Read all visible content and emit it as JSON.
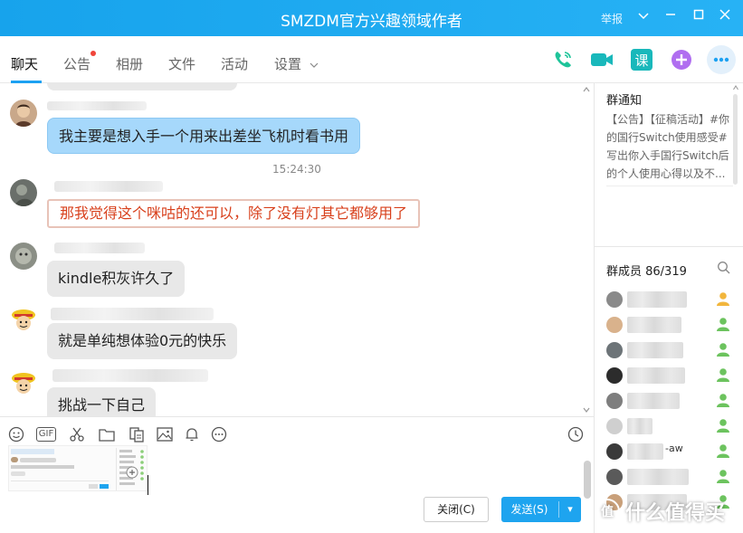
{
  "window": {
    "title": "SMZDM官方兴趣领域作者",
    "report_label": "举报"
  },
  "tabs": [
    {
      "label": "聊天",
      "active": true
    },
    {
      "label": "公告",
      "active": false,
      "has_dot": true
    },
    {
      "label": "相册",
      "active": false
    },
    {
      "label": "文件",
      "active": false
    },
    {
      "label": "活动",
      "active": false
    },
    {
      "label": "设置",
      "active": false,
      "dropdown": true
    }
  ],
  "toolbar_icons": [
    "phone-icon",
    "video-icon",
    "course-icon",
    "add-app-icon",
    "more-icon"
  ],
  "toolbar_course_glyph": "课",
  "colors": {
    "accent": "#1da1f2",
    "phone_green": "#1fc49a",
    "course_teal": "#19b8bb",
    "purple": "#a05be8",
    "member_icon": "#6cc35e"
  },
  "messages": [
    {
      "text": "我主要是想入手一个用来出差坐飞机时看书用",
      "style": "blue"
    },
    {
      "timestamp": "15:24:30"
    },
    {
      "text": "那我觉得这个咪咕的还可以，除了没有灯其它都够用了",
      "style": "red"
    },
    {
      "text": "kindle积灰许久了",
      "style": "gray"
    },
    {
      "text": "就是单纯想体验0元的快乐",
      "style": "gray"
    },
    {
      "text": "挑战一下自己",
      "style": "gray"
    }
  ],
  "input_toolbar": [
    "emoji-icon",
    "gif-icon",
    "scissors-icon",
    "folder-icon",
    "image-file-icon",
    "picture-icon",
    "bell-icon",
    "more-circle-icon",
    "history-clock-icon"
  ],
  "input_gif_label": "GIF",
  "buttons": {
    "close": "关闭(C)",
    "send": "发送(S)",
    "send_dropdown": "▾"
  },
  "notice": {
    "title": "群通知",
    "body": "【公告】【征稿活动】#你的国行Switch使用感受#写出你入手国行Switch后的个人使用心得以及不..."
  },
  "members": {
    "title": "群成员 86/319",
    "items": [
      {
        "name_text": ""
      },
      {
        "name_text": ""
      },
      {
        "name_text": ""
      },
      {
        "name_text": ""
      },
      {
        "name_text": ""
      },
      {
        "name_text": ""
      },
      {
        "name_text": "-aw"
      },
      {
        "name_text": ""
      },
      {
        "name_text": ""
      }
    ]
  },
  "watermark": {
    "text": "什么值得买",
    "logo": "值"
  }
}
